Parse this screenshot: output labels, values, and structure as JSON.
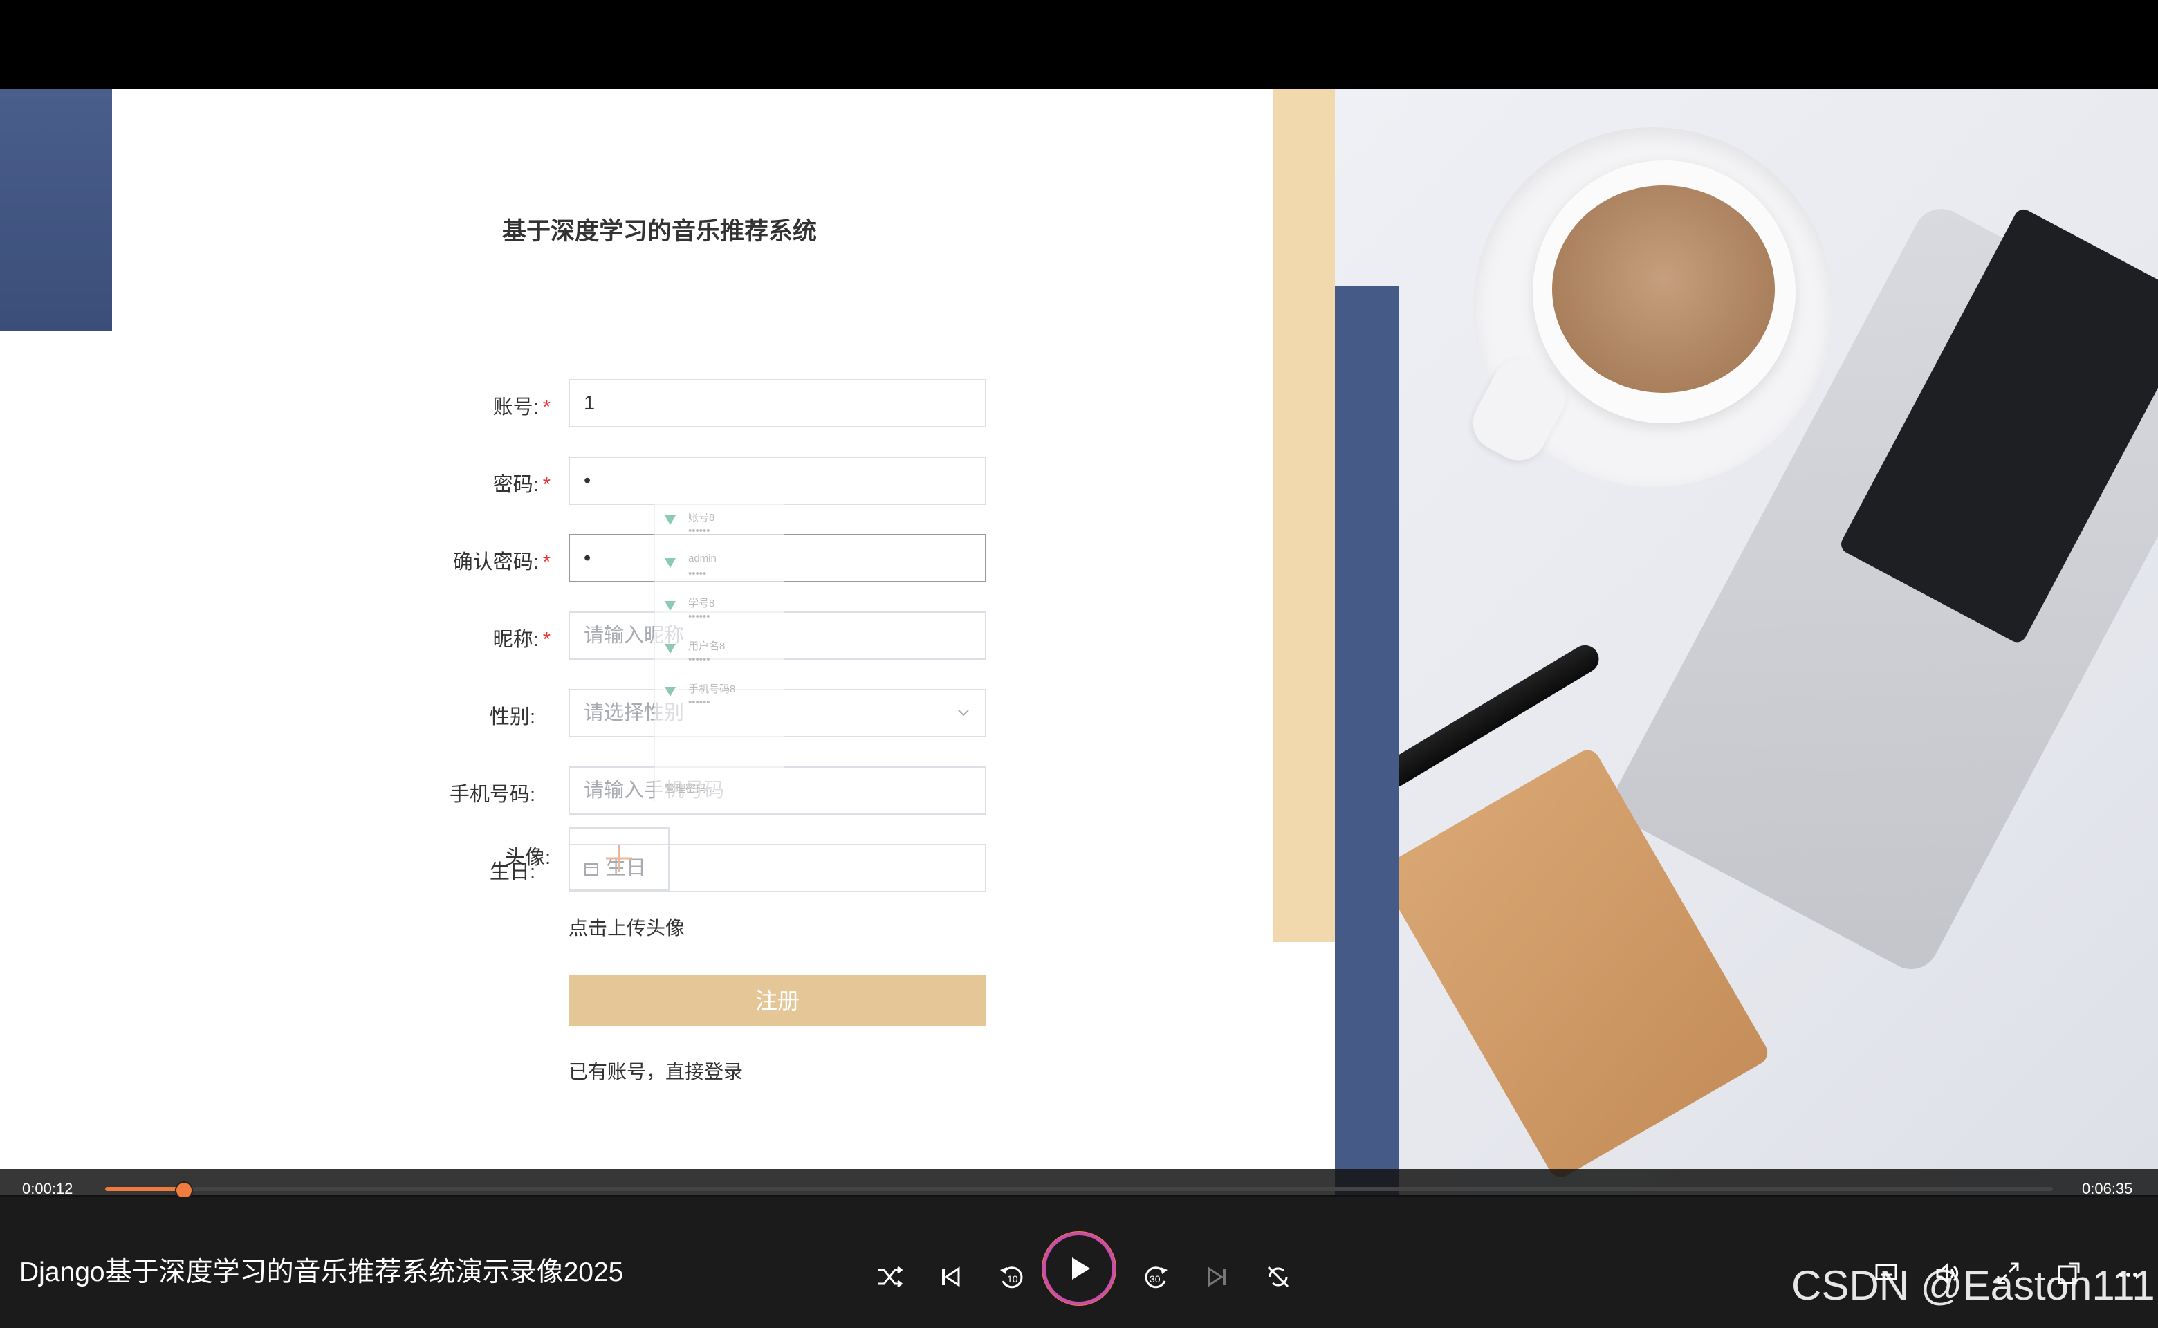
{
  "form": {
    "title": "基于深度学习的音乐推荐系统",
    "fields": [
      {
        "label": "账号",
        "required": true,
        "value": "1",
        "placeholder": ""
      },
      {
        "label": "密码",
        "required": true,
        "value": "•",
        "placeholder": ""
      },
      {
        "label": "确认密码",
        "required": true,
        "value": "•",
        "placeholder": ""
      },
      {
        "label": "昵称",
        "required": true,
        "value": "",
        "placeholder": "请输入昵称"
      },
      {
        "label": "性别",
        "required": false,
        "value": "",
        "placeholder": "请选择性别"
      },
      {
        "label": "手机号码",
        "required": false,
        "value": "",
        "placeholder": "请输入手机号码"
      },
      {
        "label": "生日",
        "required": false,
        "value": "",
        "placeholder": "生日"
      }
    ],
    "colon": ":",
    "required_mark": "*",
    "avatar_label": "头像",
    "avatar_hint": "点击上传头像",
    "register_label": "注册",
    "login_link": "已有账号，直接登录"
  },
  "autofill": {
    "items": [
      {
        "name": "账号8",
        "password": "••••••"
      },
      {
        "name": "admin",
        "password": "•••••"
      },
      {
        "name": "学号8",
        "password": "••••••"
      },
      {
        "name": "用户名8",
        "password": "••••••"
      },
      {
        "name": "手机号码8",
        "password": "••••••"
      }
    ],
    "manage_label": "管理密码..."
  },
  "player": {
    "current_time": "0:00:12",
    "total_time": "0:06:35",
    "progress_fraction": 0.018,
    "video_title": "Django基于深度学习的音乐推荐系统演示录像2025",
    "watermark": "CSDN @Easton111",
    "accent_color": "#f07b3f",
    "icons": [
      "shuffle-icon",
      "previous-icon",
      "rewind-10-icon",
      "play-icon",
      "forward-30-icon",
      "next-icon",
      "repeat-off-icon",
      "subtitles-icon",
      "volume-icon",
      "fullscreen-icon",
      "miniplayer-icon",
      "more-icon"
    ]
  },
  "colors": {
    "button": "#e4c697",
    "deco_blue": "#465a88",
    "deco_beige": "#f1d9ad"
  }
}
